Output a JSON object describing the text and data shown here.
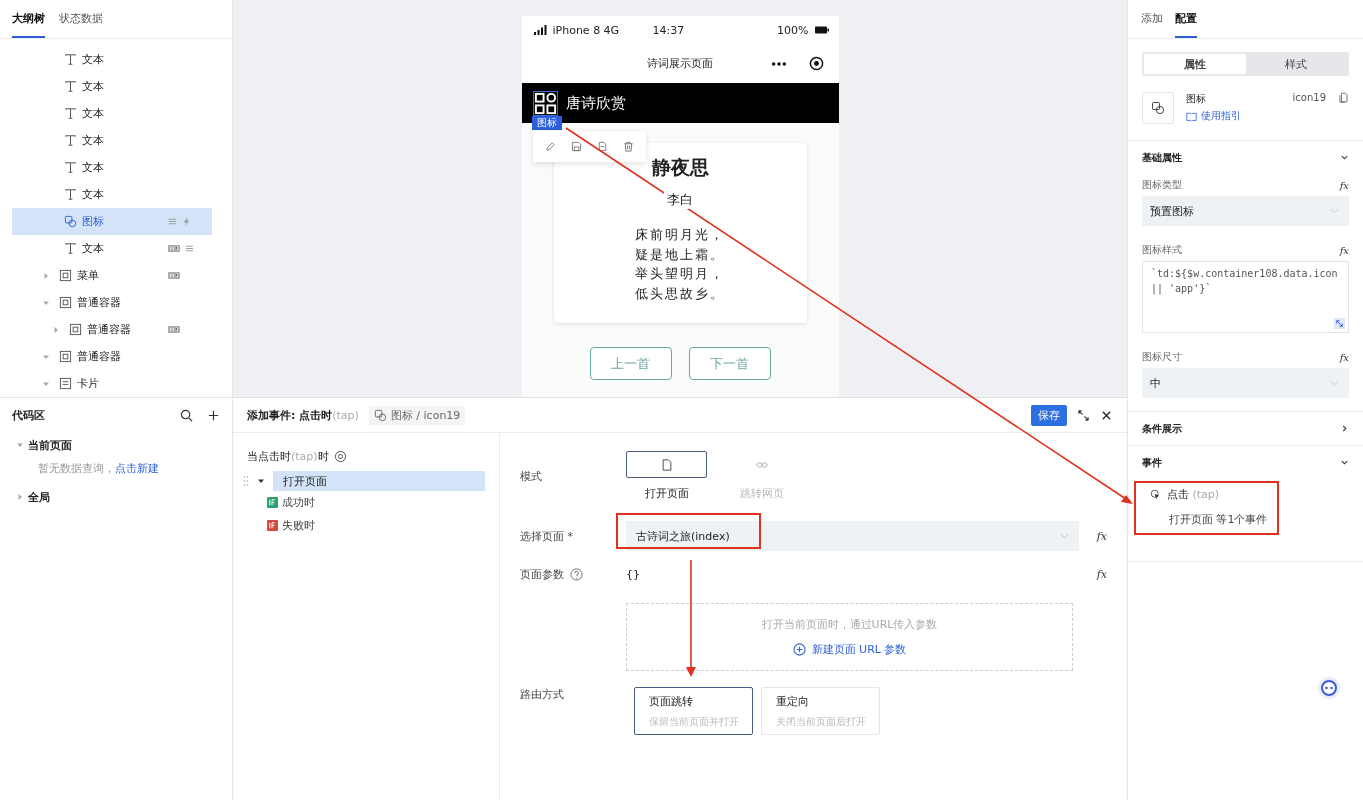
{
  "left_tabs": [
    {
      "label": "大纲树",
      "selected": true
    },
    {
      "label": "状态数据",
      "selected": false
    }
  ],
  "tree": [
    {
      "label": "文本",
      "kind": "text",
      "selected": false
    },
    {
      "label": "文本",
      "kind": "text",
      "selected": false
    },
    {
      "label": "文本",
      "kind": "text",
      "selected": false
    },
    {
      "label": "文本",
      "kind": "text",
      "selected": false
    },
    {
      "label": "文本",
      "kind": "text",
      "selected": false
    },
    {
      "label": "文本",
      "kind": "text",
      "selected": false
    },
    {
      "label": "图标",
      "kind": "icon",
      "selected": true,
      "bound": true,
      "has_event": true
    },
    {
      "label": "文本",
      "kind": "text",
      "selected": false,
      "styled": true,
      "bound": true
    },
    {
      "label": "菜单",
      "kind": "container",
      "selected": false,
      "expanded": false,
      "styled": true
    },
    {
      "label": "普通容器",
      "kind": "container",
      "selected": false,
      "expanded": true,
      "children": [
        {
          "label": "普通容器",
          "kind": "container",
          "selected": false,
          "expanded": false,
          "styled": true
        }
      ]
    },
    {
      "label": "普通容器",
      "kind": "container",
      "selected": false,
      "expanded": true
    },
    {
      "label": "卡片",
      "kind": "card",
      "selected": false,
      "expanded": true
    }
  ],
  "code_area": {
    "title": "代码区",
    "groups": [
      {
        "label": "当前页面",
        "expanded": true,
        "empty_text": "暂无数据查询，",
        "link": "点击新建"
      },
      {
        "label": "全局",
        "expanded": false
      }
    ]
  },
  "phone": {
    "carrier": "iPhone 8  4G",
    "time": "14:37",
    "battery": "100%",
    "page_title": "诗词展示页面",
    "header_title": "唐诗欣赏",
    "selection_tag": "图标",
    "poem": {
      "title": "静夜思",
      "author": "李白",
      "lines": [
        "床前明月光，",
        "疑是地上霜。",
        "举头望明月，",
        "低头思故乡。"
      ]
    },
    "buttons": [
      "上一首",
      "下一首"
    ]
  },
  "event_editor": {
    "title": "添加事件: 点击时",
    "title_hint": "(tap)",
    "target": "图标 / icon19",
    "save": "保存",
    "trigger": {
      "label": "当点击时",
      "hint": "(tap)",
      "suffix": "时"
    },
    "actions": [
      {
        "label": "打开页面",
        "selected": true,
        "expanded": true,
        "children": [
          {
            "label": "成功时",
            "color": "#2ba471"
          },
          {
            "label": "失败时",
            "color": "#d54941"
          }
        ]
      }
    ],
    "mode_label": "模式",
    "modes": [
      {
        "label": "打开页面",
        "kind": "page",
        "selected": true
      },
      {
        "label": "跳转网页",
        "kind": "link",
        "selected": false
      }
    ],
    "page_label": "选择页面",
    "page_required": "*",
    "page_value": "古诗词之旅(index)",
    "page_fx": "fx",
    "params_label": "页面参数",
    "params_value": "{}",
    "params_fx": "fx",
    "params_hint": "打开当前页面时，通过URL传入参数",
    "params_add": "新建页面 URL 参数",
    "route_label": "路由方式",
    "routes": [
      {
        "title": "页面跳转",
        "desc": "保留当前页面并打开",
        "selected": true
      },
      {
        "title": "重定向",
        "desc": "关闭当前页面后打开",
        "selected": false
      }
    ]
  },
  "right": {
    "tabs": [
      {
        "label": "添加",
        "selected": false
      },
      {
        "label": "配置",
        "selected": true
      }
    ],
    "segments": [
      {
        "label": "属性",
        "selected": true
      },
      {
        "label": "样式",
        "selected": false
      }
    ],
    "component": {
      "name": "图标",
      "guide": "使用指引",
      "id": "icon19"
    },
    "sections": [
      {
        "title": "基础属性",
        "expanded": true,
        "fields": [
          {
            "label": "图标类型",
            "kind": "select",
            "value": "预置图标",
            "fx": "fx"
          },
          {
            "label": "图标样式",
            "kind": "code",
            "value": "`td:${$w.container108.data.icon || 'app'}`",
            "fx": "fx"
          },
          {
            "label": "图标尺寸",
            "kind": "select",
            "value": "中",
            "fx": "fx"
          }
        ]
      },
      {
        "title": "条件展示",
        "expanded": false
      },
      {
        "title": "事件",
        "expanded": true,
        "events": [
          {
            "name": "点击",
            "hint": "(tap)",
            "summary": "打开页面 等1个事件"
          }
        ]
      }
    ]
  }
}
